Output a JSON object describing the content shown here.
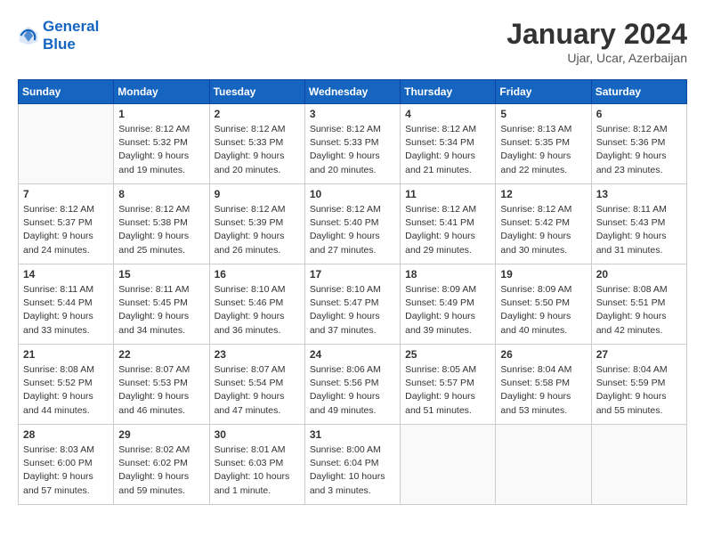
{
  "header": {
    "logo_line1": "General",
    "logo_line2": "Blue",
    "month": "January 2024",
    "location": "Ujar, Ucar, Azerbaijan"
  },
  "weekdays": [
    "Sunday",
    "Monday",
    "Tuesday",
    "Wednesday",
    "Thursday",
    "Friday",
    "Saturday"
  ],
  "weeks": [
    [
      {
        "day": "",
        "info": ""
      },
      {
        "day": "1",
        "info": "Sunrise: 8:12 AM\nSunset: 5:32 PM\nDaylight: 9 hours\nand 19 minutes."
      },
      {
        "day": "2",
        "info": "Sunrise: 8:12 AM\nSunset: 5:33 PM\nDaylight: 9 hours\nand 20 minutes."
      },
      {
        "day": "3",
        "info": "Sunrise: 8:12 AM\nSunset: 5:33 PM\nDaylight: 9 hours\nand 20 minutes."
      },
      {
        "day": "4",
        "info": "Sunrise: 8:12 AM\nSunset: 5:34 PM\nDaylight: 9 hours\nand 21 minutes."
      },
      {
        "day": "5",
        "info": "Sunrise: 8:13 AM\nSunset: 5:35 PM\nDaylight: 9 hours\nand 22 minutes."
      },
      {
        "day": "6",
        "info": "Sunrise: 8:12 AM\nSunset: 5:36 PM\nDaylight: 9 hours\nand 23 minutes."
      }
    ],
    [
      {
        "day": "7",
        "info": "Sunrise: 8:12 AM\nSunset: 5:37 PM\nDaylight: 9 hours\nand 24 minutes."
      },
      {
        "day": "8",
        "info": "Sunrise: 8:12 AM\nSunset: 5:38 PM\nDaylight: 9 hours\nand 25 minutes."
      },
      {
        "day": "9",
        "info": "Sunrise: 8:12 AM\nSunset: 5:39 PM\nDaylight: 9 hours\nand 26 minutes."
      },
      {
        "day": "10",
        "info": "Sunrise: 8:12 AM\nSunset: 5:40 PM\nDaylight: 9 hours\nand 27 minutes."
      },
      {
        "day": "11",
        "info": "Sunrise: 8:12 AM\nSunset: 5:41 PM\nDaylight: 9 hours\nand 29 minutes."
      },
      {
        "day": "12",
        "info": "Sunrise: 8:12 AM\nSunset: 5:42 PM\nDaylight: 9 hours\nand 30 minutes."
      },
      {
        "day": "13",
        "info": "Sunrise: 8:11 AM\nSunset: 5:43 PM\nDaylight: 9 hours\nand 31 minutes."
      }
    ],
    [
      {
        "day": "14",
        "info": "Sunrise: 8:11 AM\nSunset: 5:44 PM\nDaylight: 9 hours\nand 33 minutes."
      },
      {
        "day": "15",
        "info": "Sunrise: 8:11 AM\nSunset: 5:45 PM\nDaylight: 9 hours\nand 34 minutes."
      },
      {
        "day": "16",
        "info": "Sunrise: 8:10 AM\nSunset: 5:46 PM\nDaylight: 9 hours\nand 36 minutes."
      },
      {
        "day": "17",
        "info": "Sunrise: 8:10 AM\nSunset: 5:47 PM\nDaylight: 9 hours\nand 37 minutes."
      },
      {
        "day": "18",
        "info": "Sunrise: 8:09 AM\nSunset: 5:49 PM\nDaylight: 9 hours\nand 39 minutes."
      },
      {
        "day": "19",
        "info": "Sunrise: 8:09 AM\nSunset: 5:50 PM\nDaylight: 9 hours\nand 40 minutes."
      },
      {
        "day": "20",
        "info": "Sunrise: 8:08 AM\nSunset: 5:51 PM\nDaylight: 9 hours\nand 42 minutes."
      }
    ],
    [
      {
        "day": "21",
        "info": "Sunrise: 8:08 AM\nSunset: 5:52 PM\nDaylight: 9 hours\nand 44 minutes."
      },
      {
        "day": "22",
        "info": "Sunrise: 8:07 AM\nSunset: 5:53 PM\nDaylight: 9 hours\nand 46 minutes."
      },
      {
        "day": "23",
        "info": "Sunrise: 8:07 AM\nSunset: 5:54 PM\nDaylight: 9 hours\nand 47 minutes."
      },
      {
        "day": "24",
        "info": "Sunrise: 8:06 AM\nSunset: 5:56 PM\nDaylight: 9 hours\nand 49 minutes."
      },
      {
        "day": "25",
        "info": "Sunrise: 8:05 AM\nSunset: 5:57 PM\nDaylight: 9 hours\nand 51 minutes."
      },
      {
        "day": "26",
        "info": "Sunrise: 8:04 AM\nSunset: 5:58 PM\nDaylight: 9 hours\nand 53 minutes."
      },
      {
        "day": "27",
        "info": "Sunrise: 8:04 AM\nSunset: 5:59 PM\nDaylight: 9 hours\nand 55 minutes."
      }
    ],
    [
      {
        "day": "28",
        "info": "Sunrise: 8:03 AM\nSunset: 6:00 PM\nDaylight: 9 hours\nand 57 minutes."
      },
      {
        "day": "29",
        "info": "Sunrise: 8:02 AM\nSunset: 6:02 PM\nDaylight: 9 hours\nand 59 minutes."
      },
      {
        "day": "30",
        "info": "Sunrise: 8:01 AM\nSunset: 6:03 PM\nDaylight: 10 hours\nand 1 minute."
      },
      {
        "day": "31",
        "info": "Sunrise: 8:00 AM\nSunset: 6:04 PM\nDaylight: 10 hours\nand 3 minutes."
      },
      {
        "day": "",
        "info": ""
      },
      {
        "day": "",
        "info": ""
      },
      {
        "day": "",
        "info": ""
      }
    ]
  ]
}
